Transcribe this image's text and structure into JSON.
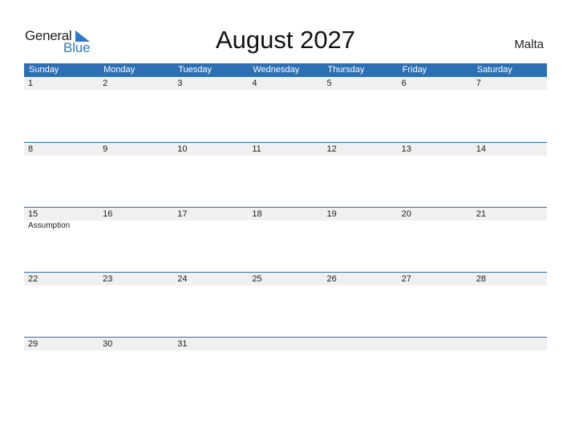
{
  "logo": {
    "word1": "General",
    "word2": "Blue",
    "accent_color": "#2a7bc9"
  },
  "title": "August 2027",
  "country": "Malta",
  "header_color": "#2d6fb3",
  "weekdays": [
    "Sunday",
    "Monday",
    "Tuesday",
    "Wednesday",
    "Thursday",
    "Friday",
    "Saturday"
  ],
  "weeks": [
    {
      "days": [
        "1",
        "2",
        "3",
        "4",
        "5",
        "6",
        "7"
      ],
      "events": [
        "",
        "",
        "",
        "",
        "",
        "",
        ""
      ]
    },
    {
      "days": [
        "8",
        "9",
        "10",
        "11",
        "12",
        "13",
        "14"
      ],
      "events": [
        "",
        "",
        "",
        "",
        "",
        "",
        ""
      ]
    },
    {
      "days": [
        "15",
        "16",
        "17",
        "18",
        "19",
        "20",
        "21"
      ],
      "events": [
        "Assumption",
        "",
        "",
        "",
        "",
        "",
        ""
      ]
    },
    {
      "days": [
        "22",
        "23",
        "24",
        "25",
        "26",
        "27",
        "28"
      ],
      "events": [
        "",
        "",
        "",
        "",
        "",
        "",
        ""
      ]
    },
    {
      "days": [
        "29",
        "30",
        "31",
        "",
        "",
        "",
        ""
      ],
      "events": [
        "",
        "",
        "",
        "",
        "",
        "",
        ""
      ]
    }
  ]
}
